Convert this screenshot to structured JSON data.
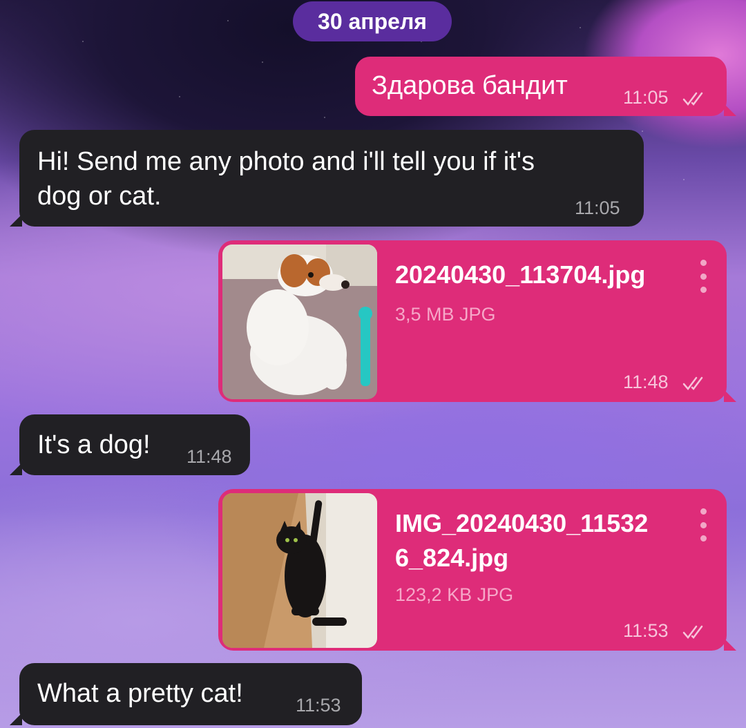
{
  "date_separator": "30 апреля",
  "messages": [
    {
      "text": "Здарова бандит",
      "time": "11:05"
    },
    {
      "text_line1": "Hi! Send me any photo and i'll tell you if it's",
      "text_line2": "dog or cat.",
      "time": "11:05"
    },
    {
      "file_name": "20240430_113704.jpg",
      "file_meta": "3,5 MB JPG",
      "time": "11:48",
      "thumbnail": "dog-photo"
    },
    {
      "text": "It's a dog!",
      "time": "11:48"
    },
    {
      "file_name_line1": "IMG_20240430_11532",
      "file_name_line2": "6_824.jpg",
      "file_meta": "123,2 KB JPG",
      "time": "11:53",
      "thumbnail": "cat-photo"
    },
    {
      "text": "What a pretty cat!",
      "time": "11:53"
    }
  ],
  "colors": {
    "outgoing_bubble": "#de2c79",
    "incoming_bubble": "#212024",
    "date_pill": "#5a2d9e"
  },
  "icons": {
    "read_status": "double-check-icon",
    "file_menu": "more-vertical-icon"
  }
}
